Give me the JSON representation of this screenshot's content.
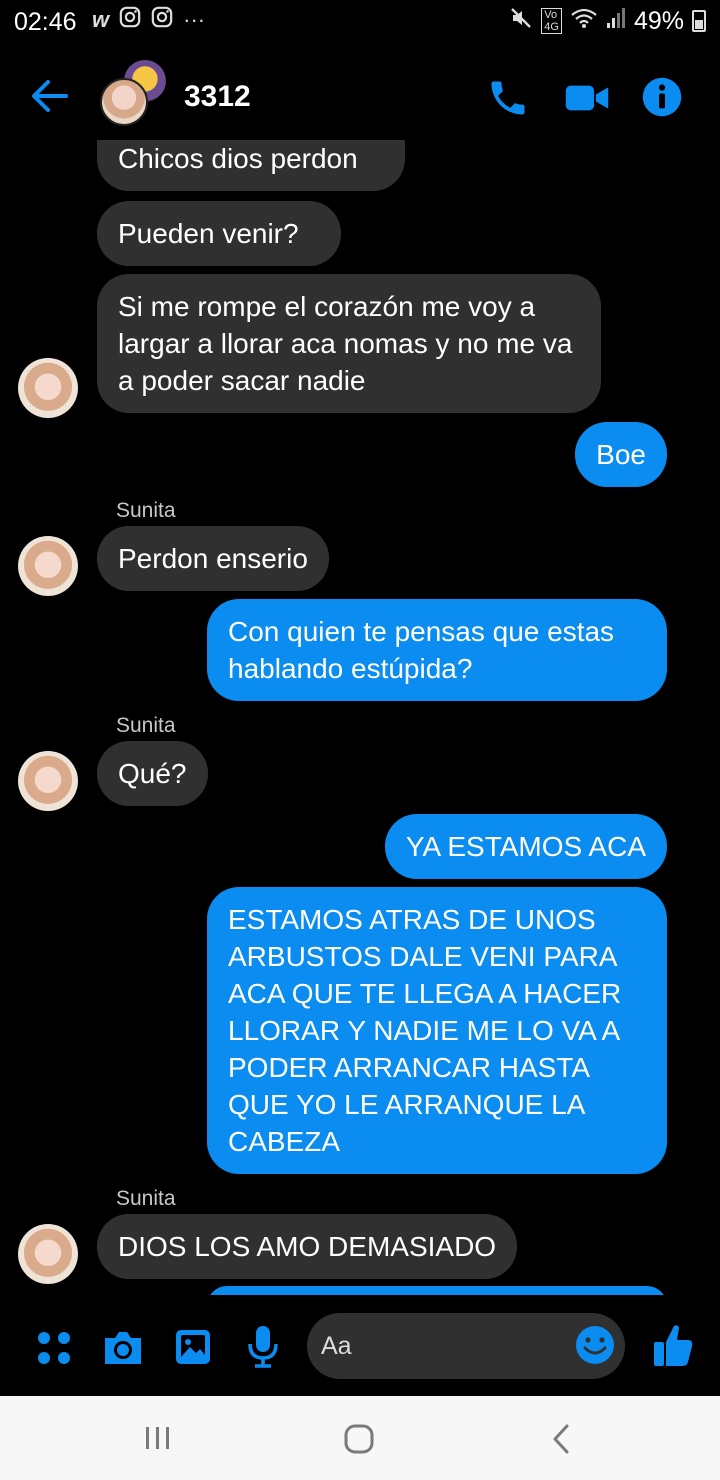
{
  "status_bar": {
    "time": "02:46",
    "battery": "49%",
    "left_icons": [
      "w-app-icon",
      "instagram-icon",
      "instagram-icon",
      "more-notifications-icon"
    ],
    "right_icons": [
      "mute-icon",
      "volte-4g-icon",
      "wifi-icon",
      "signal-icon",
      "battery-icon"
    ]
  },
  "header": {
    "title": "3312",
    "actions": [
      "phone-icon",
      "video-camera-icon",
      "info-icon"
    ]
  },
  "messages": [
    {
      "dir": "in",
      "text": "Chicos dios perdon"
    },
    {
      "dir": "in",
      "text": "Pueden venir?"
    },
    {
      "dir": "in",
      "text": "Si me rompe el corazón me voy a largar a llorar aca nomas y no me va a poder sacar nadie"
    },
    {
      "dir": "out",
      "text": "Boe"
    },
    {
      "dir": "in",
      "sender": "Sunita",
      "text": "Perdon enserio"
    },
    {
      "dir": "out",
      "text": "Con quien te pensas que estas hablando estúpida?"
    },
    {
      "dir": "in",
      "sender": "Sunita",
      "text": "Qué?"
    },
    {
      "dir": "out",
      "text": "YA ESTAMOS ACA"
    },
    {
      "dir": "out",
      "text": "ESTAMOS ATRAS DE UNOS ARBUSTOS DALE VENI PARA ACA QUE TE LLEGA A HACER LLORAR Y NADIE ME LO VA A PODER ARRANCAR HASTA QUE YO LE ARRANQUE LA CABEZA"
    },
    {
      "dir": "in",
      "sender": "Sunita",
      "text": "DIOS LOS AMO DEMASIADO"
    }
  ],
  "composer": {
    "placeholder": "Aa",
    "icons": [
      "menu-dots-icon",
      "camera-icon",
      "gallery-icon",
      "microphone-icon",
      "emoji-icon",
      "like-icon"
    ]
  },
  "nav": [
    "recents-icon",
    "home-icon",
    "back-icon"
  ],
  "colors": {
    "accent": "#0a8cf0",
    "incoming_bubble": "#303030",
    "background": "#000000"
  }
}
